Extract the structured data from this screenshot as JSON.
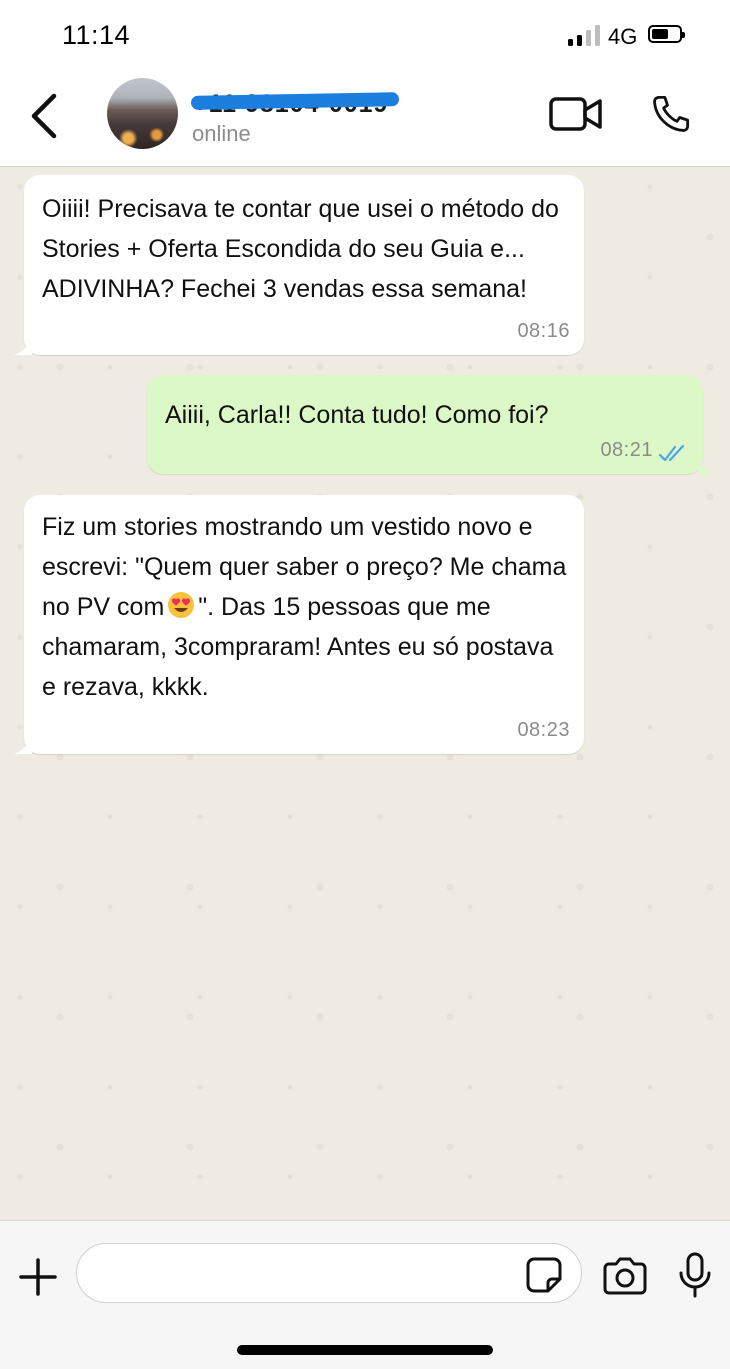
{
  "status_bar": {
    "time": "11:14",
    "network": "4G",
    "signal_bars_active": 2,
    "signal_bars_total": 4,
    "battery_level": 0.5
  },
  "header": {
    "contact_name": "+11 98104-0019",
    "contact_status": "online",
    "icons": [
      "back-chevron-icon",
      "video-call-icon",
      "phone-icon"
    ]
  },
  "messages": [
    {
      "direction": "incoming",
      "text": "Oiiii! Precisava te contar que usei o método do Stories + Oferta Escondida do seu Guia e... ADIVINHA? Fechei 3 vendas essa semana!",
      "time": "08:16"
    },
    {
      "direction": "outgoing",
      "text": "Aiiii, Carla!! Conta tudo! Como foi?",
      "time": "08:21",
      "read_status": "read"
    },
    {
      "direction": "incoming",
      "text_before_emoji": "Fiz um stories mostrando um vestido novo e escrevi: \"Quem quer saber o preço? Me chama no PV com",
      "emoji": "heart-eyes-emoji",
      "text_after_emoji": "\". Das 15 pessoas que me chamaram, 3compraram! Antes eu só postava e rezava, kkkk.",
      "time": "08:23"
    }
  ],
  "composer": {
    "placeholder": "",
    "icons": [
      "plus-icon",
      "sticker-icon",
      "camera-icon",
      "microphone-icon"
    ]
  },
  "colors": {
    "incoming_bubble": "#ffffff",
    "outgoing_bubble": "#dcf8c6",
    "chat_background": "#efeae2",
    "read_ticks": "#4fa3e6",
    "redaction": "#1c7fe0"
  }
}
